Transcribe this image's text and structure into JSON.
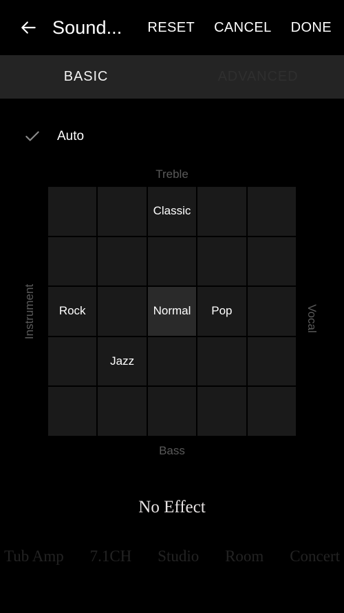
{
  "appbar": {
    "back_icon": "back-arrow-icon",
    "title": "Sound...",
    "actions": [
      {
        "label": "RESET"
      },
      {
        "label": "CANCEL"
      },
      {
        "label": "DONE"
      }
    ]
  },
  "tabs": [
    {
      "label": "BASIC",
      "active": true
    },
    {
      "label": "ADVANCED",
      "active": false
    }
  ],
  "auto": {
    "label": "Auto",
    "icon": "check-icon",
    "checked": true
  },
  "matrix": {
    "axis_top": "Treble",
    "axis_bottom": "Bass",
    "axis_left": "Instrument",
    "axis_right": "Vocal",
    "rows": 5,
    "cols": 5,
    "cells": [
      [
        {
          "label": ""
        },
        {
          "label": ""
        },
        {
          "label": "Classic"
        },
        {
          "label": ""
        },
        {
          "label": ""
        }
      ],
      [
        {
          "label": ""
        },
        {
          "label": ""
        },
        {
          "label": ""
        },
        {
          "label": ""
        },
        {
          "label": ""
        }
      ],
      [
        {
          "label": "Rock"
        },
        {
          "label": ""
        },
        {
          "label": "Normal",
          "selected": true
        },
        {
          "label": "Pop"
        },
        {
          "label": ""
        }
      ],
      [
        {
          "label": ""
        },
        {
          "label": "Jazz"
        },
        {
          "label": ""
        },
        {
          "label": ""
        },
        {
          "label": ""
        }
      ],
      [
        {
          "label": ""
        },
        {
          "label": ""
        },
        {
          "label": ""
        },
        {
          "label": ""
        },
        {
          "label": ""
        }
      ]
    ]
  },
  "effect": {
    "current": "No Effect",
    "presets": [
      {
        "label": "Tub Amp"
      },
      {
        "label": "7.1CH"
      },
      {
        "label": "Studio"
      },
      {
        "label": "Room"
      },
      {
        "label": "Concert"
      }
    ]
  },
  "colors": {
    "background": "#000000",
    "tabbar": "#242424",
    "cell": "#1a1a1a",
    "cell_selected": "#2a2a2a",
    "text_primary": "#ffffff",
    "text_muted": "#5a5a5a",
    "text_dim": "#232323"
  }
}
